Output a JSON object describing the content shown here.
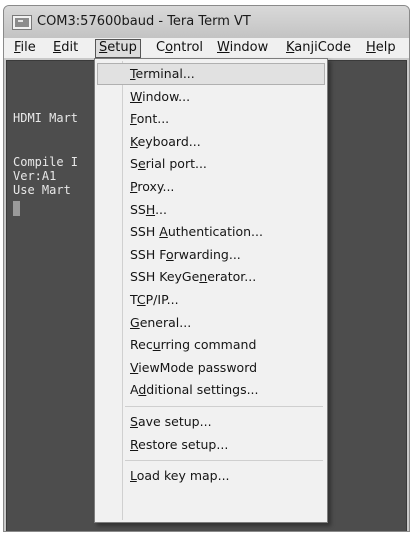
{
  "window": {
    "title": "COM3:57600baud - Tera Term VT",
    "icon": "tera-term-icon"
  },
  "menubar": {
    "items": [
      {
        "name": "file",
        "pre": "",
        "key": "F",
        "post": "ile"
      },
      {
        "name": "edit",
        "pre": "",
        "key": "E",
        "post": "dit"
      },
      {
        "name": "setup",
        "pre": "",
        "key": "S",
        "post": "etup"
      },
      {
        "name": "control",
        "pre": "C",
        "key": "o",
        "post": "ntrol"
      },
      {
        "name": "window",
        "pre": "",
        "key": "W",
        "post": "indow"
      },
      {
        "name": "kanjicode",
        "pre": "",
        "key": "K",
        "post": "anjiCode"
      },
      {
        "name": "help",
        "pre": "",
        "key": "H",
        "post": "elp"
      }
    ],
    "active": "setup"
  },
  "terminal": {
    "lines": [
      "HDMI Mart",
      "Compile I",
      "Ver:A1",
      "Use Mart"
    ]
  },
  "setup_menu": {
    "items": [
      {
        "name": "terminal",
        "pre": "",
        "key": "T",
        "post": "erminal..."
      },
      {
        "name": "window",
        "pre": "",
        "key": "W",
        "post": "indow..."
      },
      {
        "name": "font",
        "pre": "",
        "key": "F",
        "post": "ont..."
      },
      {
        "name": "keyboard",
        "pre": "",
        "key": "K",
        "post": "eyboard..."
      },
      {
        "name": "serial-port",
        "pre": "S",
        "key": "e",
        "post": "rial port..."
      },
      {
        "name": "proxy",
        "pre": "",
        "key": "P",
        "post": "roxy..."
      },
      {
        "name": "ssh",
        "pre": "SS",
        "key": "H",
        "post": "..."
      },
      {
        "name": "ssh-authentication",
        "pre": "SSH ",
        "key": "A",
        "post": "uthentication..."
      },
      {
        "name": "ssh-forwarding",
        "pre": "SSH F",
        "key": "o",
        "post": "rwarding..."
      },
      {
        "name": "ssh-keygenerator",
        "pre": "SSH KeyGe",
        "key": "n",
        "post": "erator..."
      },
      {
        "name": "tcp-ip",
        "pre": "T",
        "key": "C",
        "post": "P/IP..."
      },
      {
        "name": "general",
        "pre": "",
        "key": "G",
        "post": "eneral..."
      },
      {
        "name": "recurring-command",
        "pre": "Rec",
        "key": "u",
        "post": "rring command"
      },
      {
        "name": "viewmode-password",
        "pre": "",
        "key": "V",
        "post": "iewMode password"
      },
      {
        "name": "additional-settings",
        "pre": "A",
        "key": "d",
        "post": "ditional settings..."
      },
      {
        "name": "save-setup",
        "pre": "",
        "key": "S",
        "post": "ave setup..."
      },
      {
        "name": "restore-setup",
        "pre": "",
        "key": "R",
        "post": "estore setup..."
      },
      {
        "name": "load-key-map",
        "pre": "",
        "key": "L",
        "post": "oad key map..."
      }
    ],
    "highlighted": "terminal"
  }
}
